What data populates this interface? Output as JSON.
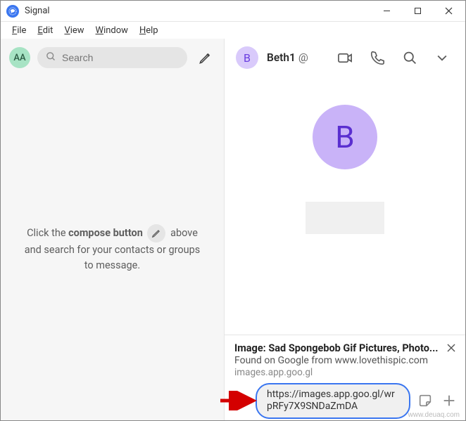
{
  "window": {
    "title": "Signal"
  },
  "menus": {
    "file": "File",
    "edit": "Edit",
    "view": "View",
    "window": "Window",
    "help": "Help"
  },
  "sidebar": {
    "user_initials": "AA",
    "search_placeholder": "Search",
    "empty": {
      "line1_prefix": "Click the ",
      "line1_bold": "compose button",
      "line1_suffix": " above",
      "line2": "and search for your contacts or groups",
      "line3": "to message."
    }
  },
  "conversation": {
    "contact_initial": "B",
    "contact_name": "Beth1",
    "at_badge": "@",
    "big_initial": "B"
  },
  "link_preview": {
    "title": "Image: Sad Spongebob Gif Pictures, Photo...",
    "subtitle": "Found on Google from www.lovethispic.com",
    "domain": "images.app.goo.gl"
  },
  "composer": {
    "text": "https://images.app.goo.gl/wrpRFy7X9SNDaZmDA"
  },
  "watermark": "www.deuaq.com",
  "colors": {
    "accent": "#3a76f0",
    "avatar_green": "#a7e3c4",
    "avatar_purple": "#c9b3f8"
  }
}
